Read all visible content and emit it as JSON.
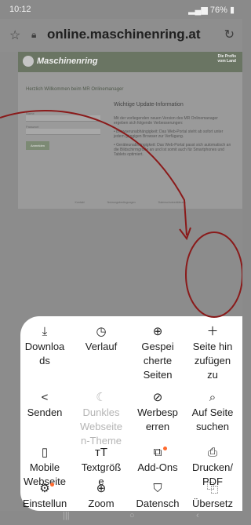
{
  "status_bar": {
    "time": "10:12",
    "battery": "76%"
  },
  "url_bar": {
    "url": "online.maschinenring.at",
    "star_icon": "star-icon",
    "lock_icon": "lock-icon",
    "reload_icon": "reload-icon"
  },
  "webpage": {
    "site_name": "Maschinenring",
    "slogan": "Die Profis vom Land",
    "welcome": "Herzlich Willkommen beim MR Onlinemanager",
    "login_name_label": "Name",
    "login_password_label": "Passwort",
    "login_button": "Anmelden",
    "update_title": "Wichtige Update-Information",
    "update_p1": "Mit der vorliegenden neuen Version des MR Onlinemanager ergeben sich folgende Verbesserungen:",
    "update_p2": "• Browserunabhängigkeit: Das Web-Portal steht ab sofort unter jedem gängigen Browser zur Verfügung.",
    "update_p3": "• Geräteunabhängigkeit: Das Web-Portal passt sich automatisch an die Bildschirmgröße an und ist somit auch für Smartphones und Tablets optimiert.",
    "footer_links": [
      "Kontakt",
      "Nutzungsbedingungen",
      "Datenschutzerklärung"
    ]
  },
  "menu": {
    "downloads": "Downloa\nds",
    "verlauf": "Verlauf",
    "gespeicherte": "Gespei\ncherte\nSeiten",
    "seite_hinzufuegen": "Seite hin\nzufügen\nzu",
    "senden": "Senden",
    "dunkles_theme": "Dunkles\nWebseite\nn-Theme",
    "werbesperren": "Werbesp\nerren",
    "auf_seite_suchen": "Auf Seite\nsuchen",
    "mobile_webseite": "Mobile\nWebseite",
    "textgroesse": "Textgröß\ne",
    "add_ons": "Add-Ons",
    "drucken_pdf": "Drucken/\nPDF",
    "einstellungen": "Einstellun\ngen",
    "zoom": "Zoom",
    "datenschutz": "Datensch\nutz",
    "uebersetzer": "Übersetz\ner"
  },
  "colors": {
    "annotation": "#8a1a1a",
    "notification_dot": "#ff6a2e",
    "sheet": "#ffffff"
  }
}
